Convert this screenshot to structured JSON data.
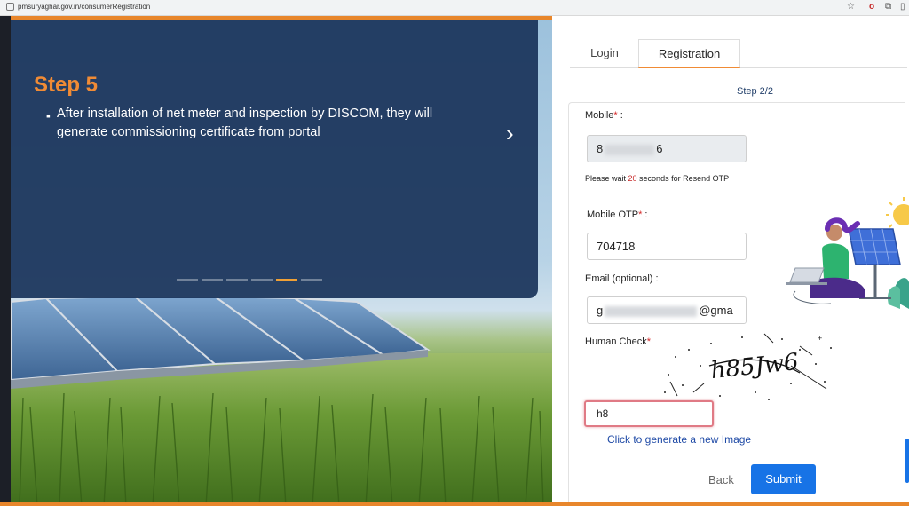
{
  "browser": {
    "url": "pmsuryaghar.gov.in/consumerRegistration"
  },
  "slide": {
    "title": "Step 5",
    "text": "After installation of net meter and inspection by DISCOM, they will generate commissioning certificate from portal",
    "total_slides": 6,
    "active_slide": 5
  },
  "tabs": {
    "login": "Login",
    "registration": "Registration",
    "active": "Registration"
  },
  "form": {
    "step": "Step 2/2",
    "mobile_label": "Mobile",
    "mobile_prefix": "8",
    "mobile_suffix": "6",
    "wait_prefix": "Please wait ",
    "wait_seconds": "20",
    "wait_suffix": " seconds for Resend OTP",
    "otp_label": "Mobile OTP",
    "otp_value": "704718",
    "email_label": "Email (optional) :",
    "email_prefix": "g",
    "email_suffix": "@gma",
    "human_check_label": "Human Check",
    "captcha_text": "h85Jw6",
    "captcha_input": "h8",
    "new_image_link": "Click to generate a new Image",
    "back": "Back",
    "submit": "Submit"
  },
  "colors": {
    "accent_orange": "#f08b35",
    "submit_blue": "#1773e6",
    "slide_navy": "#1a345a",
    "link_blue": "#1f4aa6"
  }
}
